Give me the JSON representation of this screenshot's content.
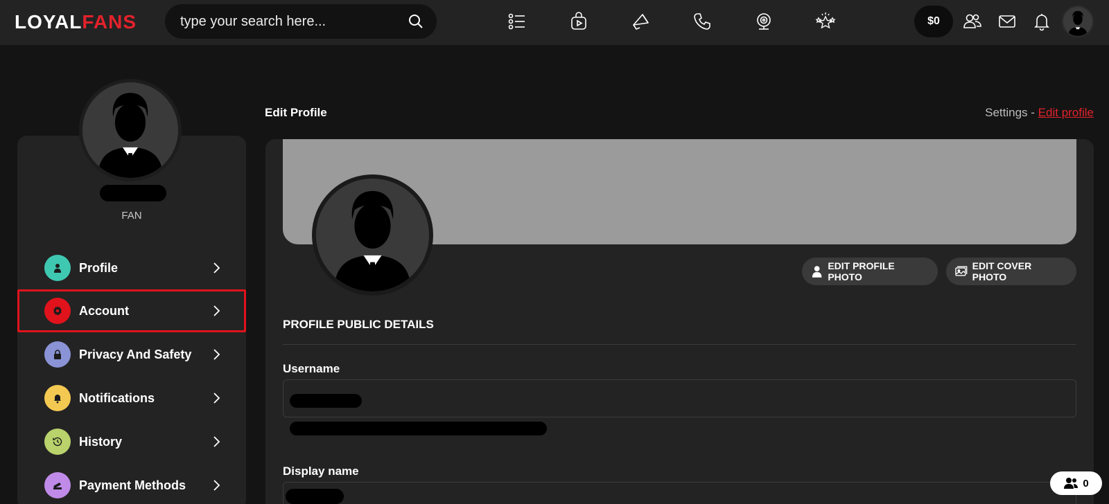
{
  "brand": {
    "logo_left": "LOYAL",
    "logo_right": "FANS",
    "accent": "#e3222b"
  },
  "search": {
    "placeholder": "type your search here..."
  },
  "nav_icons": [
    "list-icon",
    "video-bag-icon",
    "megaphone-icon",
    "phone-icon",
    "webcam-icon",
    "stars-icon"
  ],
  "header": {
    "balance": "$0"
  },
  "sidebar": {
    "role": "FAN",
    "items": [
      {
        "label": "Profile",
        "icon": "user-icon",
        "color": "#3fc8b1"
      },
      {
        "label": "Account",
        "icon": "gear-icon",
        "color": "#e0131c"
      },
      {
        "label": "Privacy And Safety",
        "icon": "lock-icon",
        "color": "#8a93d6"
      },
      {
        "label": "Notifications",
        "icon": "bell-icon",
        "color": "#f4c952"
      },
      {
        "label": "History",
        "icon": "history-icon",
        "color": "#b9d26b"
      },
      {
        "label": "Payment Methods",
        "icon": "card-icon",
        "color": "#c08be8"
      }
    ]
  },
  "main": {
    "title": "Edit Profile",
    "breadcrumb_prefix": "Settings - ",
    "breadcrumb_link": "Edit profile",
    "edit_profile_photo": "EDIT PROFILE PHOTO",
    "edit_cover_photo": "EDIT COVER PHOTO",
    "section_title": "PROFILE PUBLIC DETAILS",
    "username_label": "Username",
    "display_name_label": "Display name"
  },
  "online_count": "0"
}
